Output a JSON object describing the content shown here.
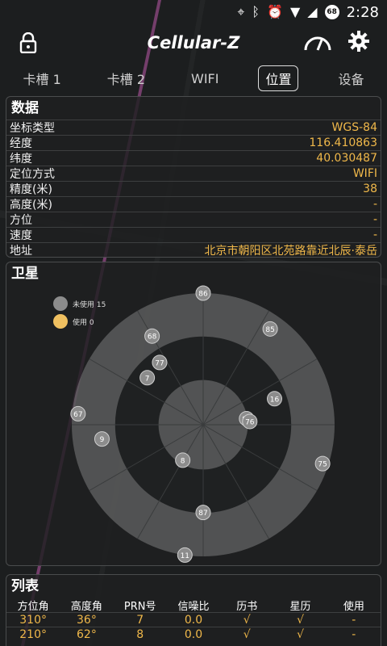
{
  "status_bar": {
    "time": "2:28",
    "battery": "68"
  },
  "app": {
    "title": "Cellular-Z"
  },
  "tabs": [
    {
      "label": "卡槽 1"
    },
    {
      "label": "卡槽 2"
    },
    {
      "label": "WIFI"
    },
    {
      "label": "位置",
      "active": true
    },
    {
      "label": "设备"
    }
  ],
  "data_panel": {
    "title": "数据",
    "rows": [
      {
        "label": "坐标类型",
        "value": "WGS-84"
      },
      {
        "label": "经度",
        "value": "116.410863"
      },
      {
        "label": "纬度",
        "value": "40.030487"
      },
      {
        "label": "定位方式",
        "value": "WIFI"
      },
      {
        "label": "精度(米)",
        "value": "38"
      },
      {
        "label": "高度(米)",
        "value": "-"
      },
      {
        "label": "方位",
        "value": "-"
      },
      {
        "label": "速度",
        "value": "-"
      },
      {
        "label": "地址",
        "value": "北京市朝阳区北苑路靠近北辰·泰岳"
      }
    ]
  },
  "satellite_panel": {
    "title": "卫星",
    "legend": [
      {
        "label": "未使用 15",
        "color": "#8c8c8c"
      },
      {
        "label": "使用 0",
        "color": "#f0c060"
      }
    ],
    "satellites": [
      {
        "prn": "86",
        "azimuth": 0,
        "elevation": 0
      },
      {
        "prn": "85",
        "azimuth": 35,
        "elevation": 10
      },
      {
        "prn": "68",
        "azimuth": 330,
        "elevation": 20
      },
      {
        "prn": "77",
        "azimuth": 325,
        "elevation": 38
      },
      {
        "prn": "7",
        "azimuth": 310,
        "elevation": 40
      },
      {
        "prn": "16",
        "azimuth": 70,
        "elevation": 38
      },
      {
        "prn": "86",
        "azimuth": 82,
        "elevation": 60
      },
      {
        "prn": "76",
        "azimuth": 86,
        "elevation": 58
      },
      {
        "prn": "67",
        "azimuth": 275,
        "elevation": 4
      },
      {
        "prn": "9",
        "azimuth": 262,
        "elevation": 20
      },
      {
        "prn": "75",
        "azimuth": 108,
        "elevation": 4
      },
      {
        "prn": "8",
        "azimuth": 210,
        "elevation": 62
      },
      {
        "prn": "87",
        "azimuth": 180,
        "elevation": 30
      },
      {
        "prn": "11",
        "azimuth": 188,
        "elevation": 0
      }
    ],
    "colors": {
      "unused": "#8c8c8c",
      "used": "#f0c060",
      "ring": "#d8d8d8"
    }
  },
  "list_panel": {
    "title": "列表",
    "headers": [
      "方位角",
      "高度角",
      "PRN号",
      "信噪比",
      "历书",
      "星历",
      "使用"
    ],
    "rows": [
      [
        "310°",
        "36°",
        "7",
        "0.0",
        "√",
        "√",
        "-"
      ],
      [
        "210°",
        "62°",
        "8",
        "0.0",
        "√",
        "√",
        "-"
      ]
    ]
  }
}
